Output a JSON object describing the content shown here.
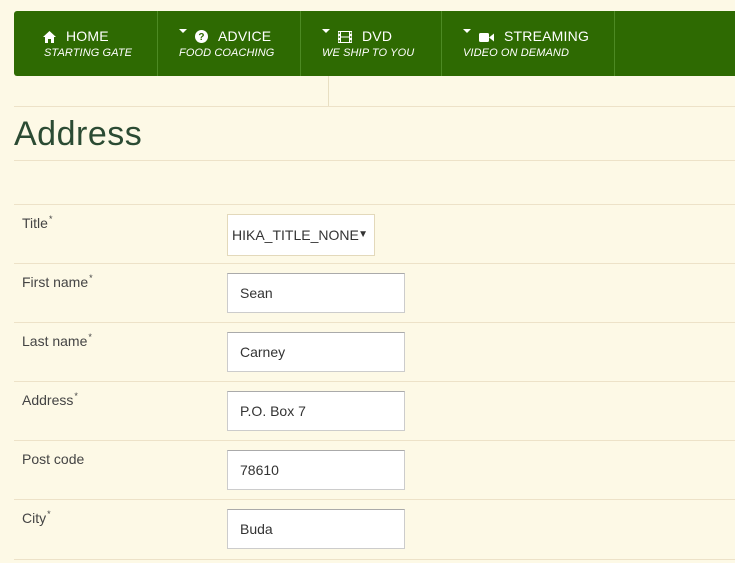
{
  "nav": [
    {
      "label": "HOME",
      "sub": "STARTING GATE",
      "icon": "home-icon",
      "caret": false
    },
    {
      "label": "ADVICE",
      "sub": "FOOD COACHING",
      "icon": "question-circle-icon",
      "caret": true
    },
    {
      "label": "DVD",
      "sub": "WE SHIP TO YOU",
      "icon": "film-icon",
      "caret": true
    },
    {
      "label": "STREAMING",
      "sub": "VIDEO ON DEMAND",
      "icon": "video-camera-icon",
      "caret": true
    }
  ],
  "page": {
    "title": "Address"
  },
  "form": {
    "required_mark": "*",
    "title": {
      "label": "Title",
      "value": "HIKA_TITLE_NONE",
      "arrow": "▼"
    },
    "first_name": {
      "label": "First name",
      "value": "Sean"
    },
    "last_name": {
      "label": "Last name",
      "value": "Carney"
    },
    "address": {
      "label": "Address",
      "value": "P.O. Box 7"
    },
    "post_code": {
      "label": "Post code",
      "value": "78610"
    },
    "city": {
      "label": "City",
      "value": "Buda"
    }
  },
  "colors": {
    "nav_bg": "#2e6a02",
    "page_bg": "#fdf9e6",
    "title": "#2b4b33"
  }
}
